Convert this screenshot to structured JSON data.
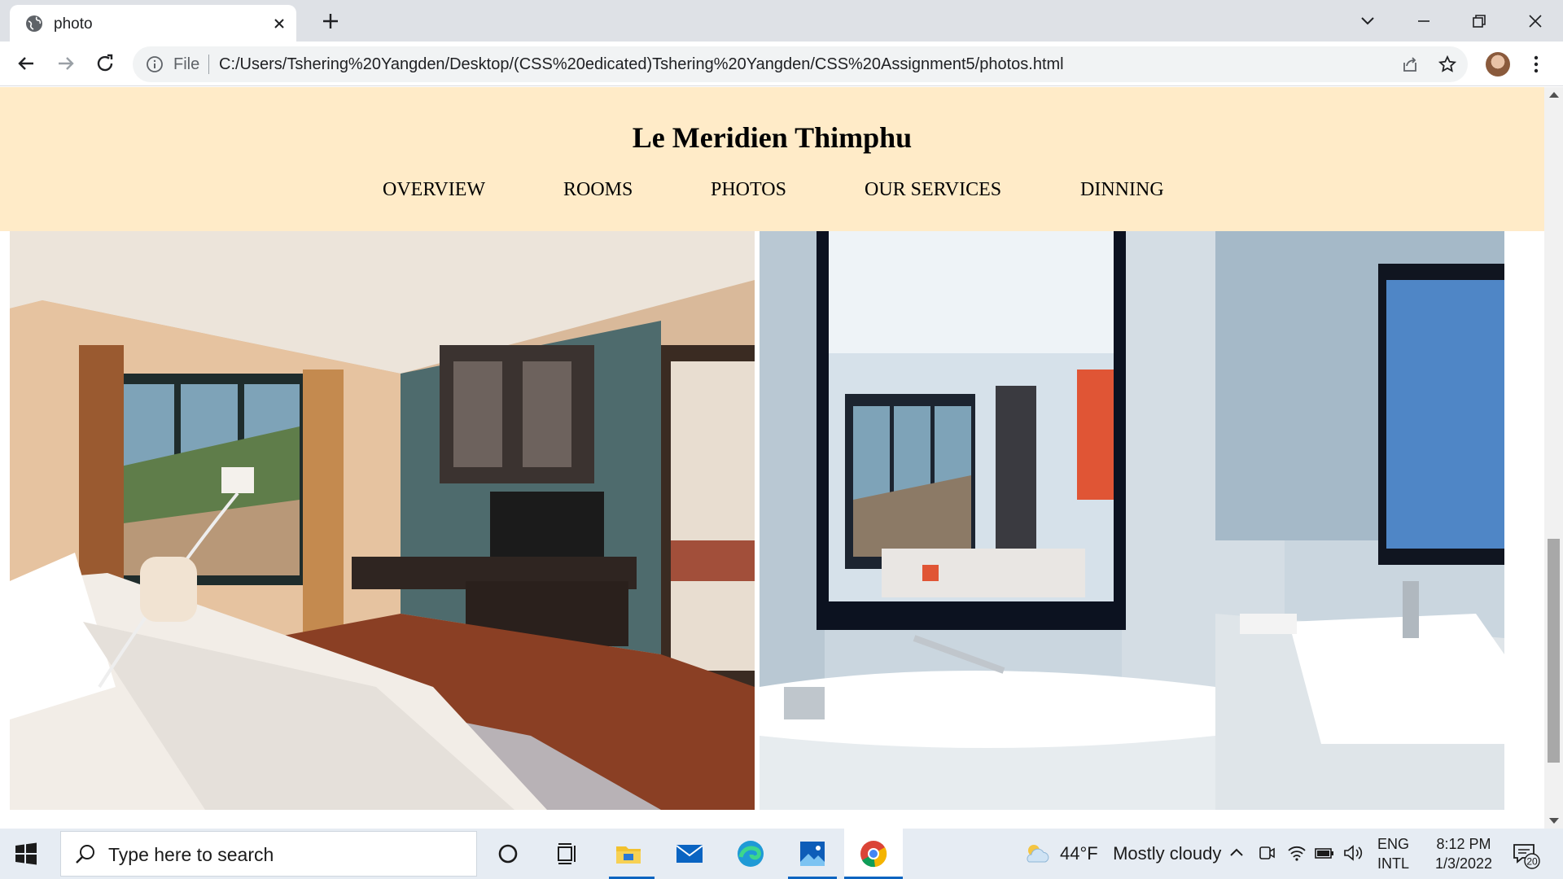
{
  "browser": {
    "tab_title": "photo",
    "omnibox_scheme_label": "File",
    "url": "C:/Users/Tshering%20Yangden/Desktop/(CSS%20edicated)Tshering%20Yangden/CSS%20Assignment5/photos.html"
  },
  "site": {
    "title": "Le Meridien Thimphu",
    "nav": [
      {
        "label": "OVERVIEW"
      },
      {
        "label": "ROOMS"
      },
      {
        "label": "PHOTOS"
      },
      {
        "label": "OUR SERVICES"
      },
      {
        "label": "DINNING"
      }
    ],
    "header_bg": "#ffebc8"
  },
  "taskbar": {
    "search_placeholder": "Type here to search",
    "weather_temp": "44°F",
    "weather_desc": "Mostly cloudy",
    "lang_line1": "ENG",
    "lang_line2": "INTL",
    "time": "8:12 PM",
    "date": "1/3/2022",
    "notification_count": "20"
  }
}
